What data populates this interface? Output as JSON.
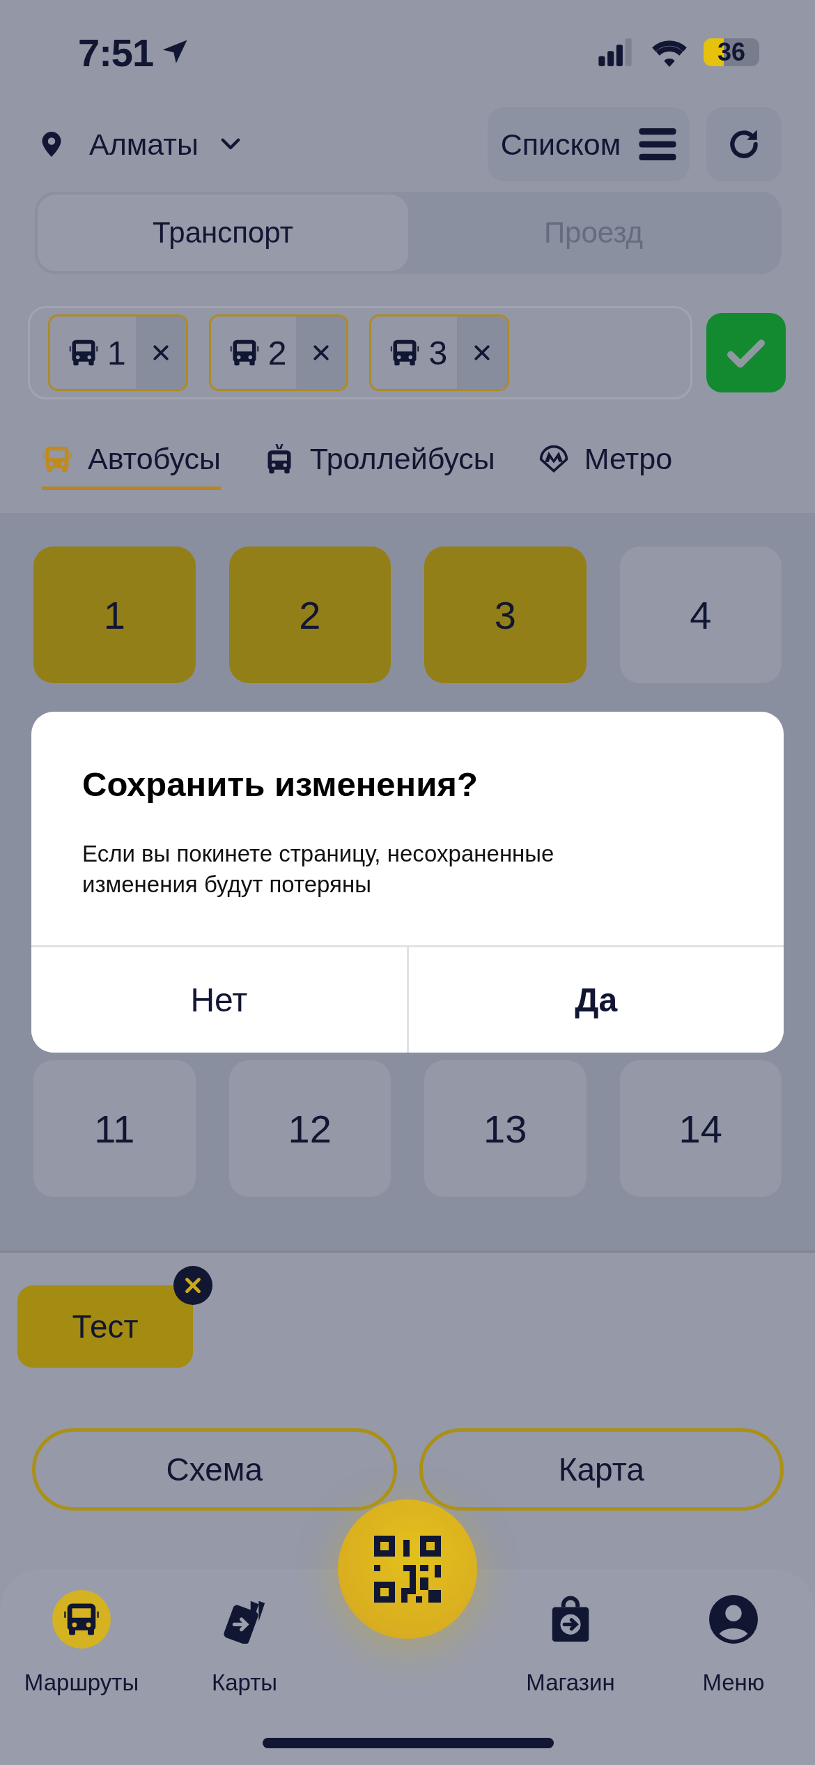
{
  "status_bar": {
    "time": "7:51",
    "battery": "36"
  },
  "header": {
    "city": "Алматы",
    "view_button": "Списком"
  },
  "segments": [
    {
      "label": "Транспорт",
      "selected": true
    },
    {
      "label": "Проезд",
      "selected": false
    }
  ],
  "chips": [
    {
      "label": "1"
    },
    {
      "label": "2"
    },
    {
      "label": "3"
    }
  ],
  "tabs": [
    {
      "label": "Автобусы",
      "kind": "bus",
      "selected": true
    },
    {
      "label": "Троллейбусы",
      "kind": "trolleybus",
      "selected": false
    },
    {
      "label": "Метро",
      "kind": "metro",
      "selected": false
    }
  ],
  "routes": [
    {
      "label": "1",
      "selected": true
    },
    {
      "label": "2",
      "selected": true
    },
    {
      "label": "3",
      "selected": true
    },
    {
      "label": "4",
      "selected": false
    },
    {
      "label": "11",
      "selected": false
    },
    {
      "label": "12",
      "selected": false
    },
    {
      "label": "13",
      "selected": false
    },
    {
      "label": "14",
      "selected": false
    }
  ],
  "favorites": [
    {
      "label": "Тест"
    }
  ],
  "actions": [
    {
      "label": "Схема"
    },
    {
      "label": "Карта"
    }
  ],
  "nav": [
    {
      "kind": "routes",
      "label": "Маршруты",
      "selected": true
    },
    {
      "kind": "cards",
      "label": "Карты",
      "selected": false
    },
    {
      "kind": "scan"
    },
    {
      "kind": "shop",
      "label": "Магазин",
      "selected": false
    },
    {
      "kind": "menu",
      "label": "Меню",
      "selected": false
    }
  ],
  "dialog": {
    "title": "Сохранить изменения?",
    "message": "Если вы покинете страницу, несохраненные изменения будут потеряны",
    "buttons": [
      {
        "label": "Нет",
        "kind": "cancel"
      },
      {
        "label": "Да",
        "kind": "confirm"
      }
    ]
  }
}
